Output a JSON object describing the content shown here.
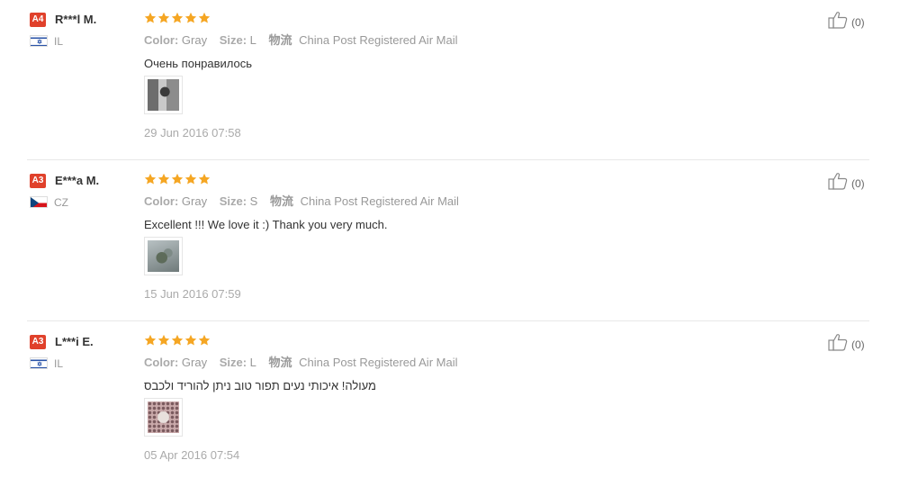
{
  "reviews": [
    {
      "level_badge": "A4",
      "buyer": "R***l M.",
      "country": "IL",
      "flag": "israel",
      "rating": 5,
      "color_label": "Color:",
      "color_value": "Gray",
      "size_label": "Size:",
      "size_value": "L",
      "shipping_icon": "物流",
      "shipping": "China Post Registered Air Mail",
      "text": "Очень понравилось",
      "date": "29 Jun 2016 07:58",
      "helpful": "(0)"
    },
    {
      "level_badge": "A3",
      "buyer": "E***a M.",
      "country": "CZ",
      "flag": "czech",
      "rating": 5,
      "color_label": "Color:",
      "color_value": "Gray",
      "size_label": "Size:",
      "size_value": "S",
      "shipping_icon": "物流",
      "shipping": "China Post Registered Air Mail",
      "text": "Excellent !!! We love it :) Thank you very much.",
      "date": "15 Jun 2016 07:59",
      "helpful": "(0)"
    },
    {
      "level_badge": "A3",
      "buyer": "L***i E.",
      "country": "IL",
      "flag": "israel",
      "rating": 5,
      "color_label": "Color:",
      "color_value": "Gray",
      "size_label": "Size:",
      "size_value": "L",
      "shipping_icon": "物流",
      "shipping": "China Post Registered Air Mail",
      "text": "מעולה! איכותי נעים תפור טוב ניתן להוריד ולכבס",
      "date": "05 Apr 2016 07:54",
      "helpful": "(0)"
    }
  ],
  "colors": {
    "badge": "#e0412b",
    "star": "#f5a623"
  }
}
